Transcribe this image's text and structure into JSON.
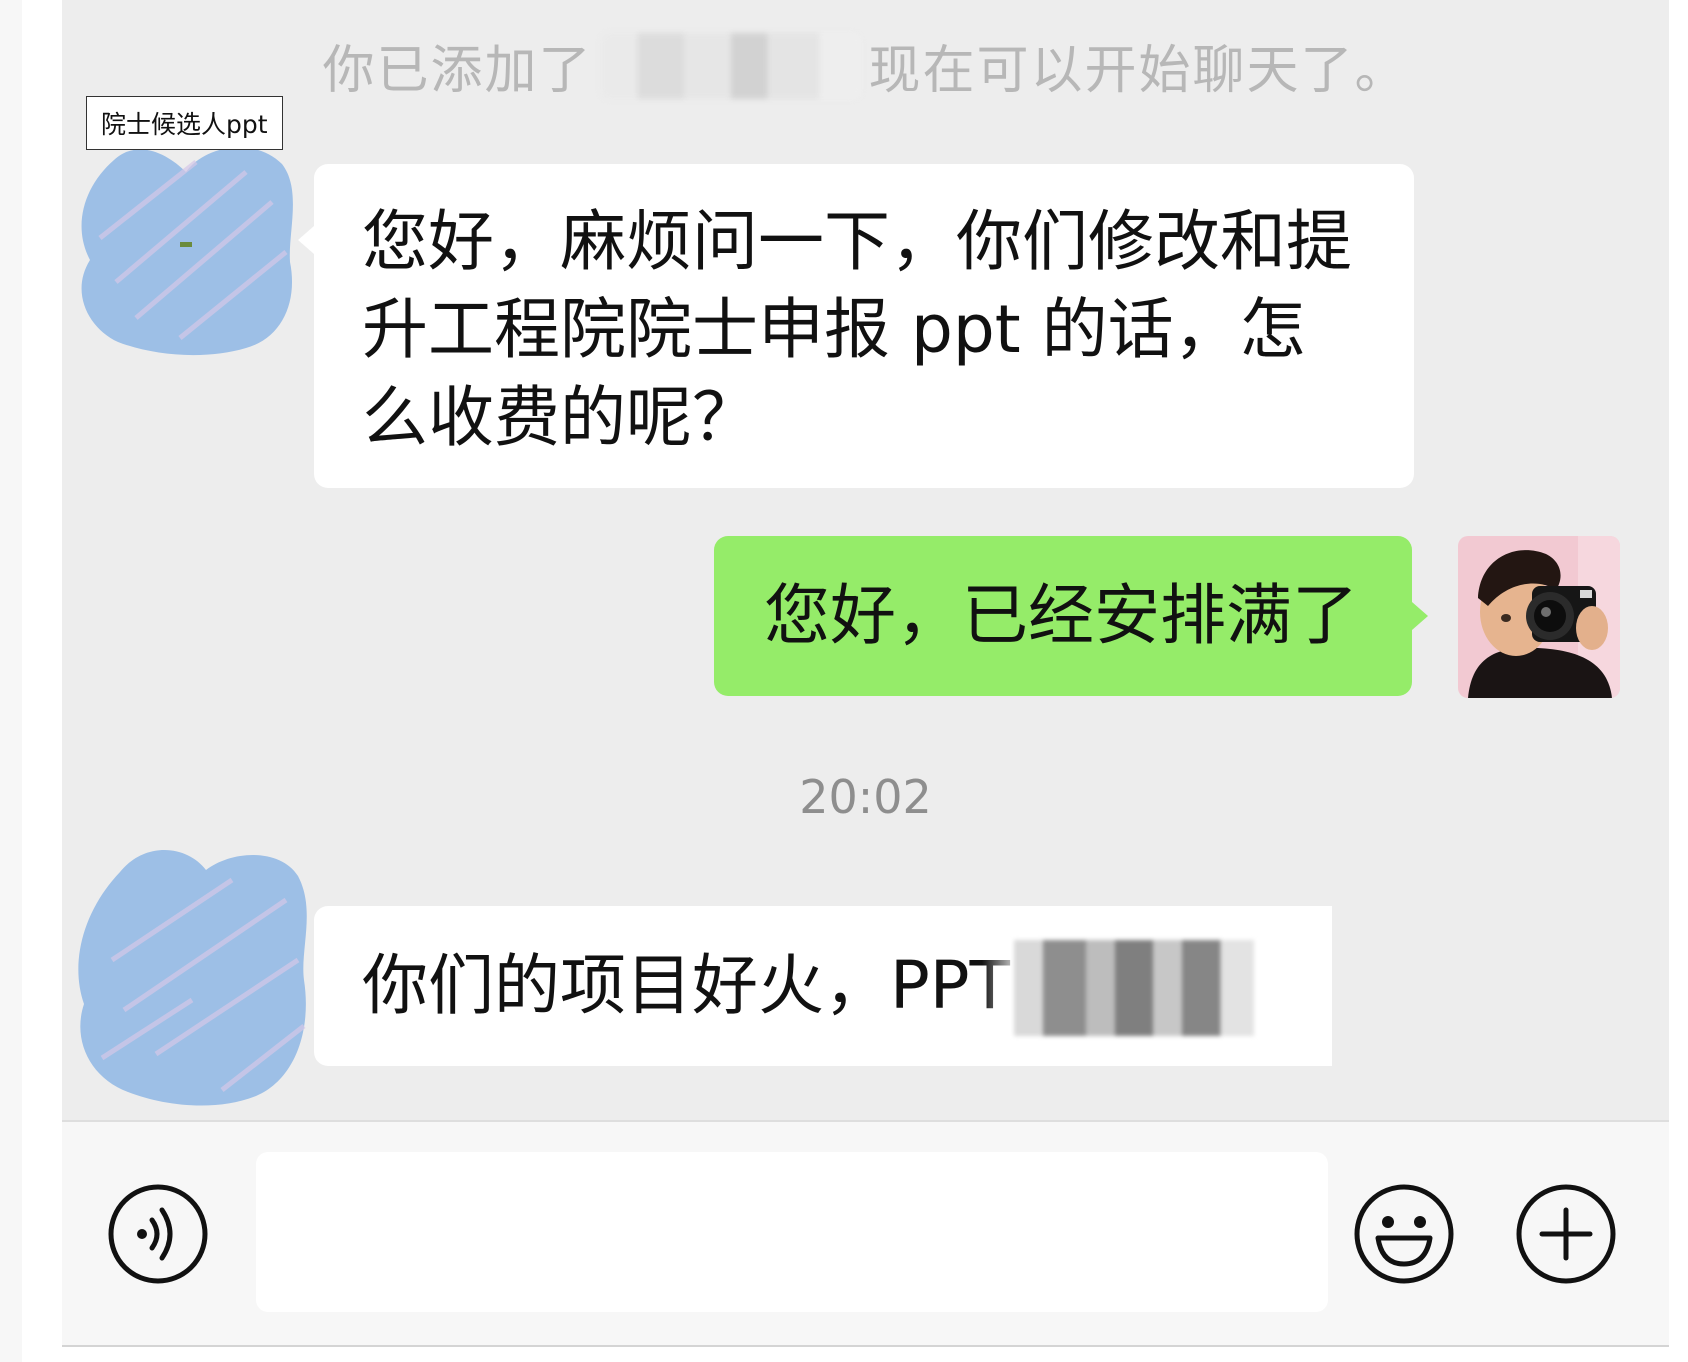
{
  "system_message": {
    "prefix": "你已添加了",
    "suffix": "现在可以开始聊天了。"
  },
  "label_tag": "院士候选人ppt",
  "messages": [
    {
      "side": "left",
      "text": "您好，麻烦问一下，你们修改和提升工程院院士申报 ppt 的话，怎么收费的呢？"
    },
    {
      "side": "right",
      "text": "您好，已经安排满了"
    },
    {
      "side": "left",
      "text": "你们的项目好火，PPT"
    }
  ],
  "timestamp": "20:02",
  "input_bar": {
    "voice_icon": "voice-icon",
    "emoji_icon": "emoji-icon",
    "plus_icon": "plus-icon"
  },
  "colors": {
    "chat_background": "#ededed",
    "incoming_bubble": "#ffffff",
    "outgoing_bubble": "#95ec69",
    "avatar_blue": "#9dbfe6"
  }
}
